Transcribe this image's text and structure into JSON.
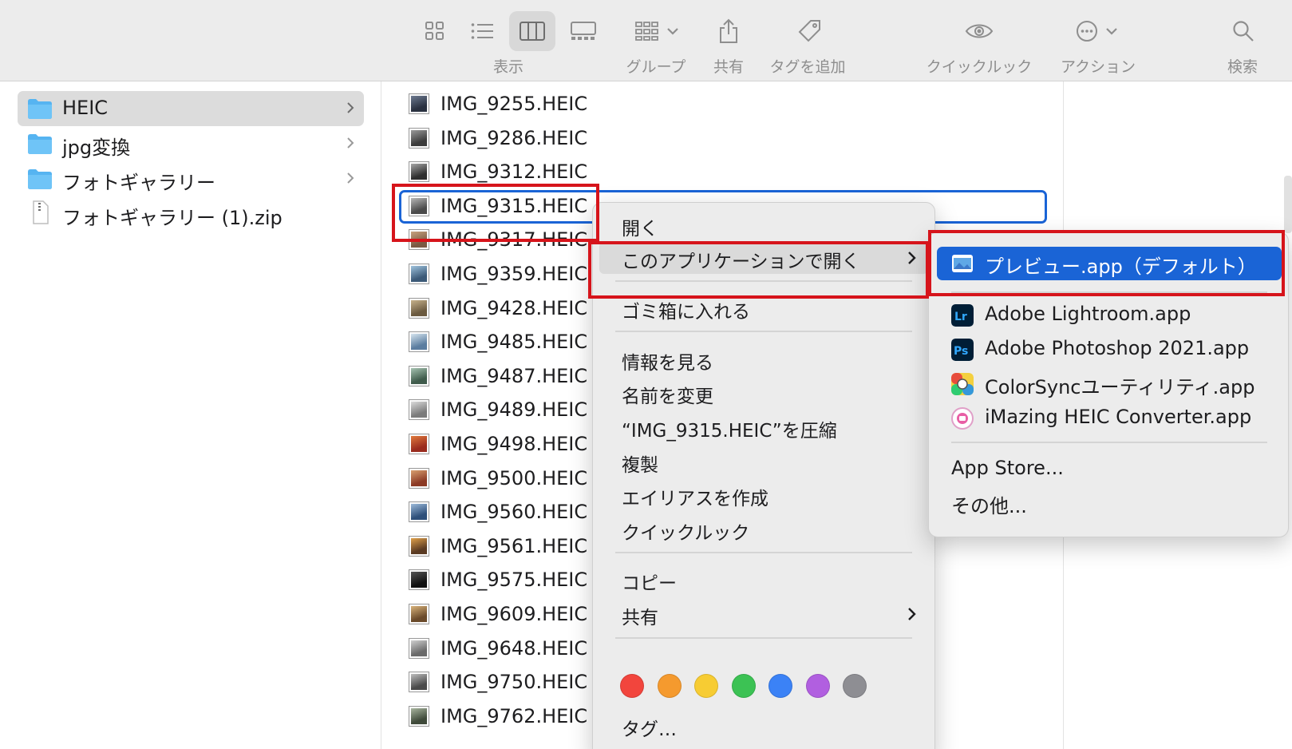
{
  "toolbar": {
    "items": [
      {
        "label": "表示",
        "icon": "view-icon-group"
      },
      {
        "label": "グループ",
        "icon": "group-icon"
      },
      {
        "label": "共有",
        "icon": "share-icon"
      },
      {
        "label": "タグを追加",
        "icon": "tag-icon"
      },
      {
        "label": "クイックルック",
        "icon": "eye-icon"
      },
      {
        "label": "アクション",
        "icon": "ellipsis-circle-icon"
      },
      {
        "label": "検索",
        "icon": "search-icon"
      }
    ]
  },
  "sidebar": {
    "items": [
      {
        "name": "HEIC",
        "type": "folder",
        "selected": true
      },
      {
        "name": "jpg変換",
        "type": "folder"
      },
      {
        "name": "フォトギャラリー",
        "type": "folder"
      },
      {
        "name": "フォトギャラリー (1).zip",
        "type": "zip"
      }
    ]
  },
  "files": [
    "IMG_9255.HEIC",
    "IMG_9286.HEIC",
    "IMG_9312.HEIC",
    "IMG_9315.HEIC",
    "IMG_9317.HEIC",
    "IMG_9359.HEIC",
    "IMG_9428.HEIC",
    "IMG_9485.HEIC",
    "IMG_9487.HEIC",
    "IMG_9489.HEIC",
    "IMG_9498.HEIC",
    "IMG_9500.HEIC",
    "IMG_9560.HEIC",
    "IMG_9561.HEIC",
    "IMG_9575.HEIC",
    "IMG_9609.HEIC",
    "IMG_9648.HEIC",
    "IMG_9750.HEIC",
    "IMG_9762.HEIC"
  ],
  "selected_file": "IMG_9315.HEIC",
  "context_menu": {
    "open": "開く",
    "open_with": "このアプリケーションで開く",
    "trash": "ゴミ箱に入れる",
    "get_info": "情報を見る",
    "rename": "名前を変更",
    "compress": "“IMG_9315.HEIC”を圧縮",
    "duplicate": "複製",
    "make_alias": "エイリアスを作成",
    "quick_look": "クイックルック",
    "copy": "コピー",
    "share": "共有",
    "tags": "タグ…",
    "tag_colors": [
      "#f2453d",
      "#f59a2e",
      "#f7cc33",
      "#3cc254",
      "#3b82f6",
      "#b15fe0",
      "#8e8e93"
    ]
  },
  "submenu": {
    "default_app": "プレビュー.app（デフォルト）",
    "apps": [
      {
        "label": "Adobe Lightroom.app",
        "icon": "lightroom-icon"
      },
      {
        "label": "Adobe Photoshop 2021.app",
        "icon": "photoshop-icon"
      },
      {
        "label": "ColorSyncユーティリティ.app",
        "icon": "colorsync-icon"
      },
      {
        "label": "iMazing HEIC Converter.app",
        "icon": "imazing-icon"
      }
    ],
    "app_store": "App Store...",
    "other": "その他..."
  },
  "colors": {
    "accent": "#1a64d6",
    "highlight": "#d6141b"
  }
}
